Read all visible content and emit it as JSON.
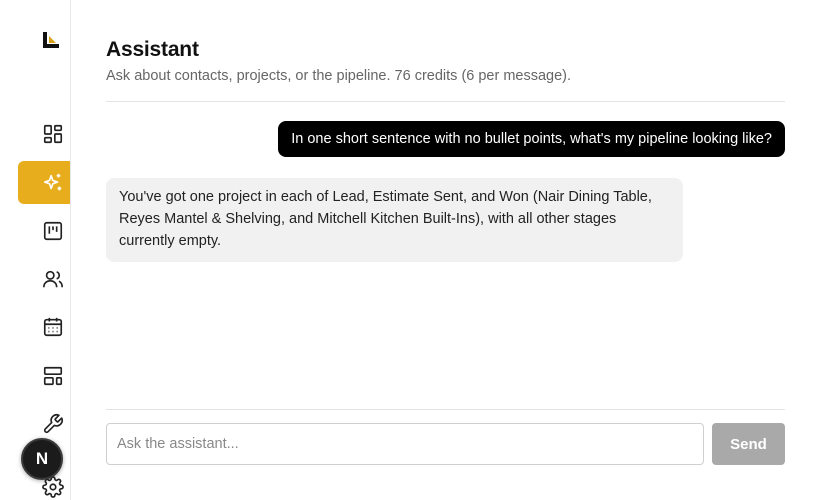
{
  "sidebar": {
    "logo_icon": "brand-logo-icon",
    "items": [
      {
        "icon": "dashboard-icon"
      },
      {
        "icon": "sparkles-icon",
        "active": true
      },
      {
        "icon": "kanban-icon"
      },
      {
        "icon": "users-icon"
      },
      {
        "icon": "calendar-icon"
      },
      {
        "icon": "layout-template-icon"
      },
      {
        "icon": "wrench-icon"
      },
      {
        "icon": "gear-icon"
      }
    ],
    "avatar_initial": "N"
  },
  "header": {
    "title": "Assistant",
    "subtitle": "Ask about contacts, projects, or the pipeline. 76 credits (6 per message)."
  },
  "messages": [
    {
      "role": "user",
      "text": "In one short sentence with no bullet points, what's my pipeline looking like?"
    },
    {
      "role": "assistant",
      "text": "You've got one project in each of Lead, Estimate Sent, and Won (Nair Dining Table, Reyes Mantel & Shelving, and Mitchell Kitchen Built-Ins), with all other stages currently empty."
    }
  ],
  "composer": {
    "placeholder": "Ask the assistant...",
    "value": "",
    "send_label": "Send"
  },
  "colors": {
    "accent": "#e8ad1d",
    "user_bubble": "#000000",
    "assistant_bubble": "#f1f1f1",
    "send_disabled": "#a9a9a9"
  }
}
